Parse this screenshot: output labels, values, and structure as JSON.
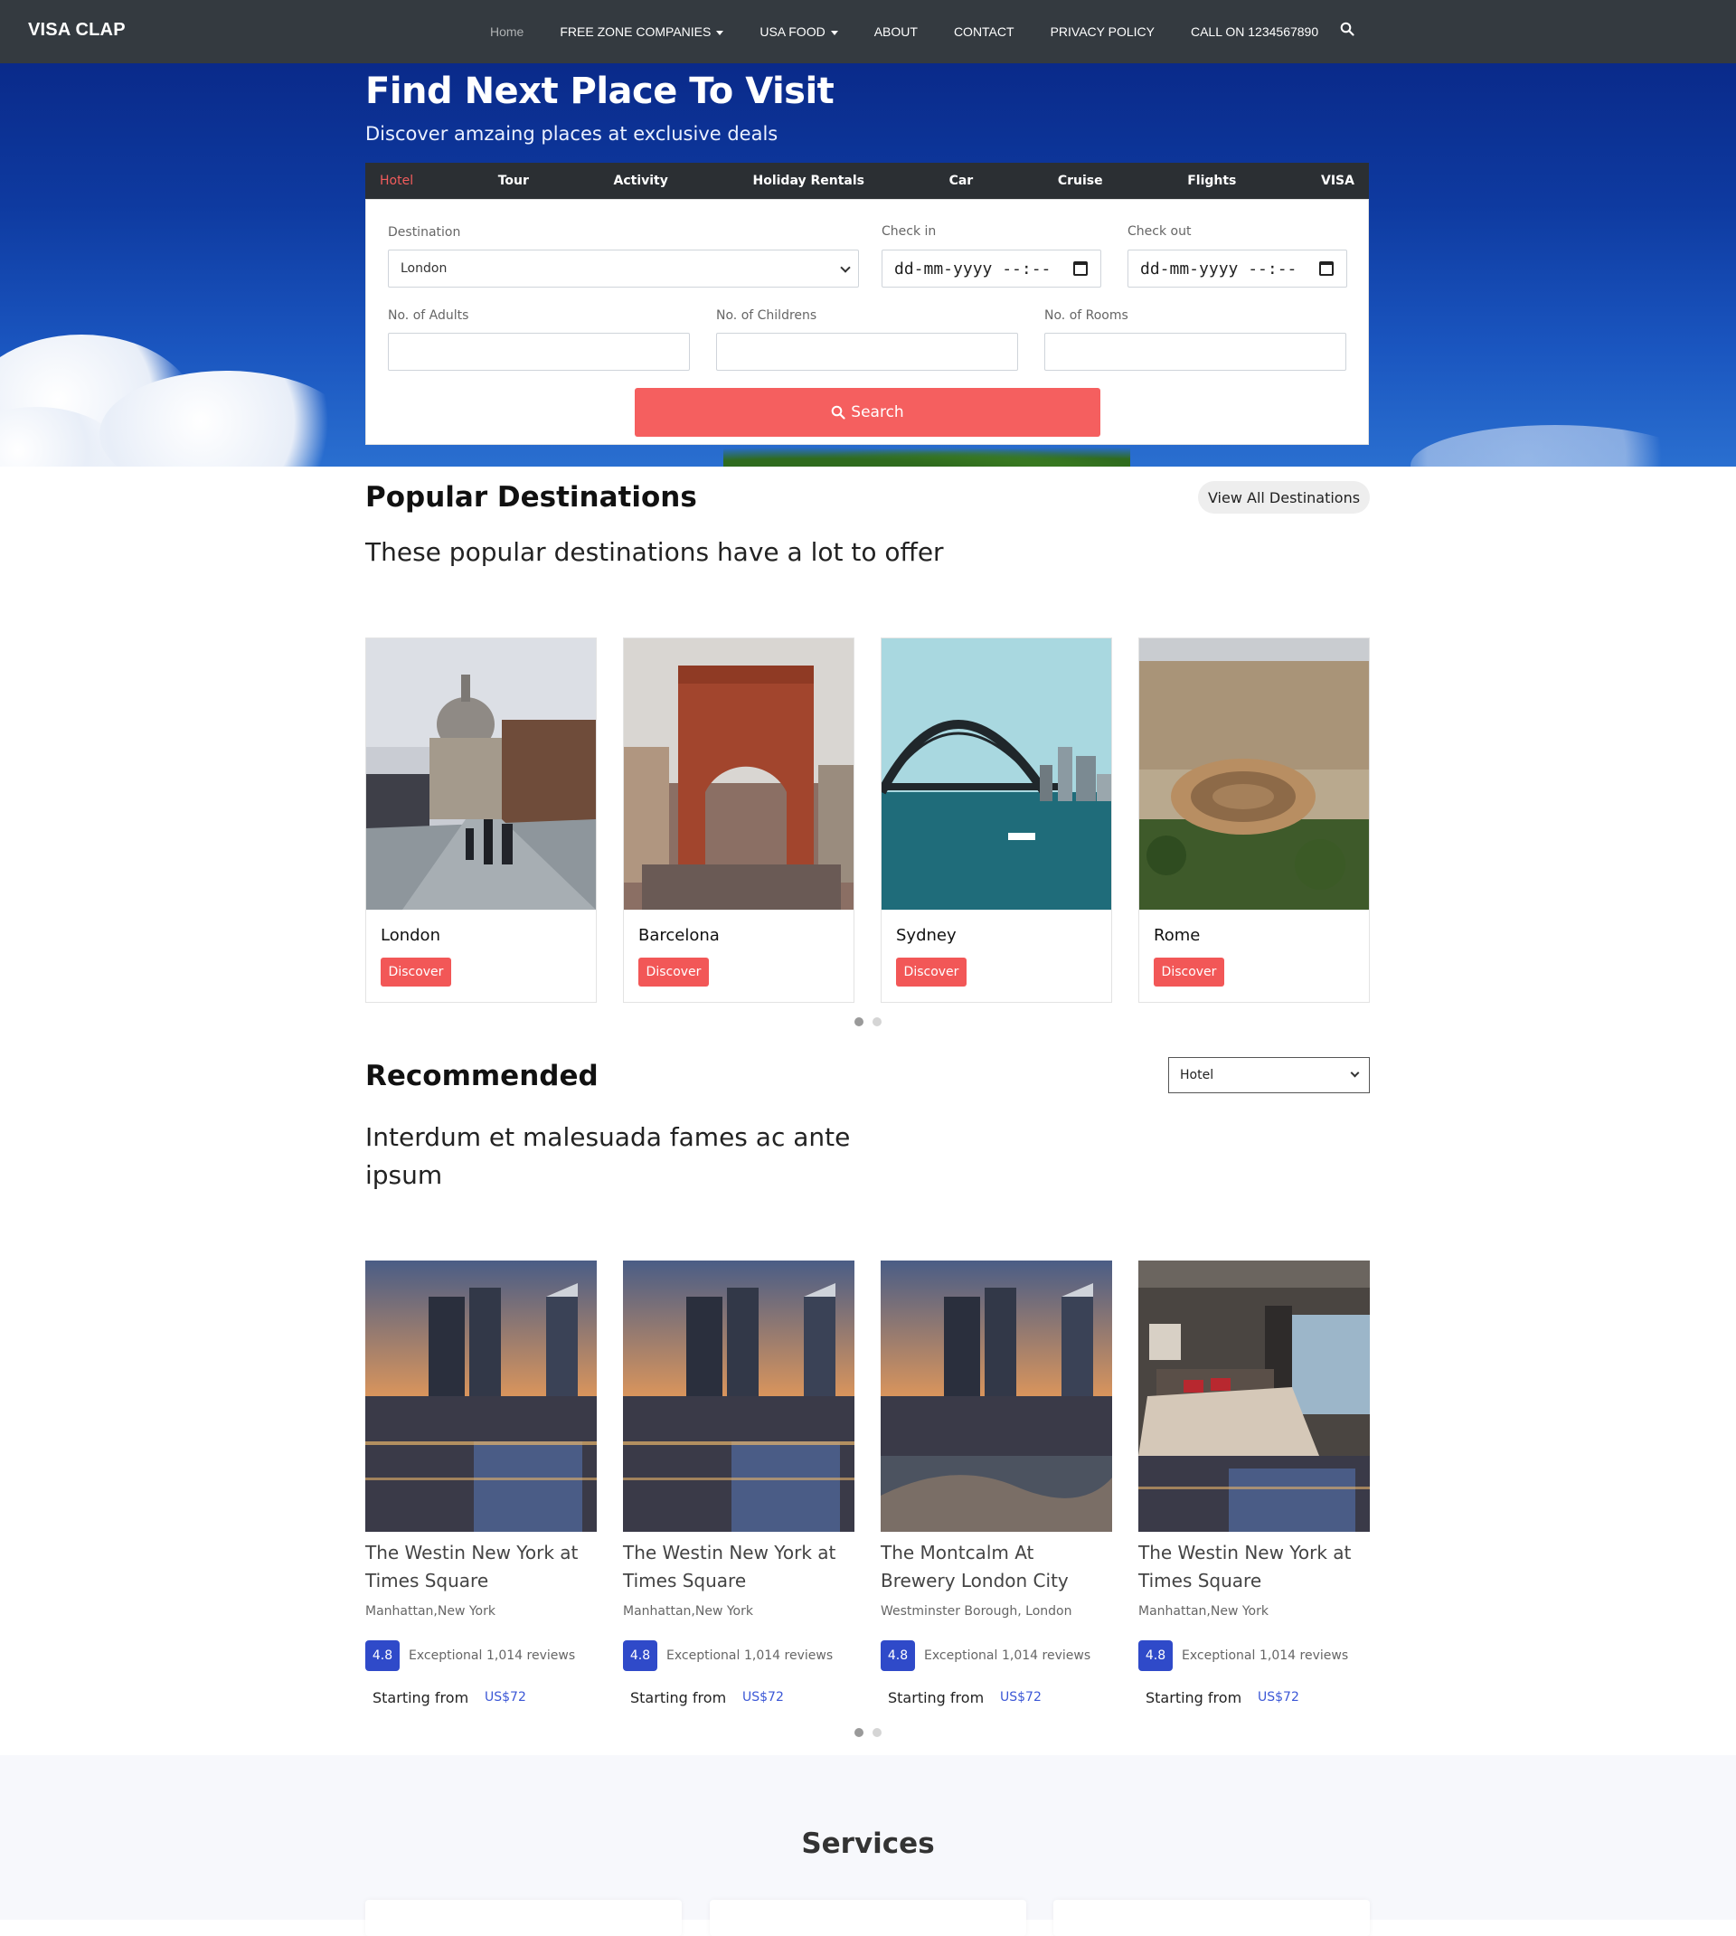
{
  "navbar": {
    "brand": "VISA CLAP",
    "links": [
      {
        "label": "Home"
      },
      {
        "label": "FREE ZONE COMPANIES"
      },
      {
        "label": "USA FOOD"
      },
      {
        "label": "ABOUT"
      },
      {
        "label": "CONTACT"
      },
      {
        "label": "PRIVACY POLICY"
      },
      {
        "label": "CALL ON 1234567890"
      }
    ],
    "search_icon": "search-icon"
  },
  "hero": {
    "title": "Find Next Place To Visit",
    "subtitle": "Discover amzaing places at exclusive deals",
    "tabs": [
      "Hotel",
      "Tour",
      "Activity",
      "Holiday Rentals",
      "Car",
      "Cruise",
      "Flights",
      "VISA"
    ],
    "active_tab": "Hotel",
    "form": {
      "destination_label": "Destination",
      "destination_value": "London",
      "checkin_label": "Check in",
      "checkin_value": "dd-mm-yyyy --:--",
      "checkout_label": "Check out",
      "checkout_value": "dd-mm-yyyy --:--",
      "adults_label": "No. of Adults",
      "children_label": "No. of Childrens",
      "rooms_label": "No. of Rooms",
      "search_label": "Search"
    }
  },
  "popular": {
    "title": "Popular Destinations",
    "view_all": "View All Destinations",
    "subtitle": "These popular destinations have a lot to offer",
    "cards": [
      {
        "name": "London",
        "button": "Discover"
      },
      {
        "name": "Barcelona",
        "button": "Discover"
      },
      {
        "name": "Sydney",
        "button": "Discover"
      },
      {
        "name": "Rome",
        "button": "Discover"
      }
    ]
  },
  "recommended": {
    "title": "Recommended",
    "subtitle": "Interdum et malesuada fames ac ante ipsum",
    "filter_value": "Hotel",
    "cards": [
      {
        "name": "The Westin New York at Times Square",
        "location": "Manhattan,New York",
        "score": "4.8",
        "score_word": "Exceptional",
        "reviews": "1,014 reviews",
        "starting": "Starting from",
        "price": "US$72"
      },
      {
        "name": "The Westin New York at Times Square",
        "location": "Manhattan,New York",
        "score": "4.8",
        "score_word": "Exceptional",
        "reviews": "1,014 reviews",
        "starting": "Starting from",
        "price": "US$72"
      },
      {
        "name": "The Montcalm At Brewery London City",
        "location": "Westminster Borough, London",
        "score": "4.8",
        "score_word": "Exceptional",
        "reviews": "1,014 reviews",
        "starting": "Starting from",
        "price": "US$72"
      },
      {
        "name": "The Westin New York at Times Square",
        "location": "Manhattan,New York",
        "score": "4.8",
        "score_word": "Exceptional",
        "reviews": "1,014 reviews",
        "starting": "Starting from",
        "price": "US$72"
      }
    ]
  },
  "services": {
    "title": "Services"
  },
  "colors": {
    "navbar": "#343a40",
    "accent": "#f55f5f",
    "score": "#2f4ac9",
    "price": "#3b57d6"
  }
}
